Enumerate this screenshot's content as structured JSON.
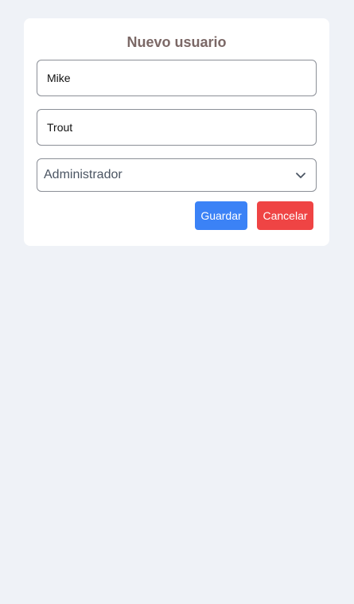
{
  "form": {
    "title": "Nuevo usuario",
    "first_name_value": "Mike",
    "last_name_value": "Trout",
    "role_selected": "Administrador",
    "save_label": "Guardar",
    "cancel_label": "Cancelar"
  },
  "icons": {
    "select_arrow": "chevron-down-icon"
  },
  "colors": {
    "background": "#eff2f7",
    "card": "#ffffff",
    "title": "#7b6866",
    "save_button": "#3b82f6",
    "cancel_button": "#ef4444"
  }
}
